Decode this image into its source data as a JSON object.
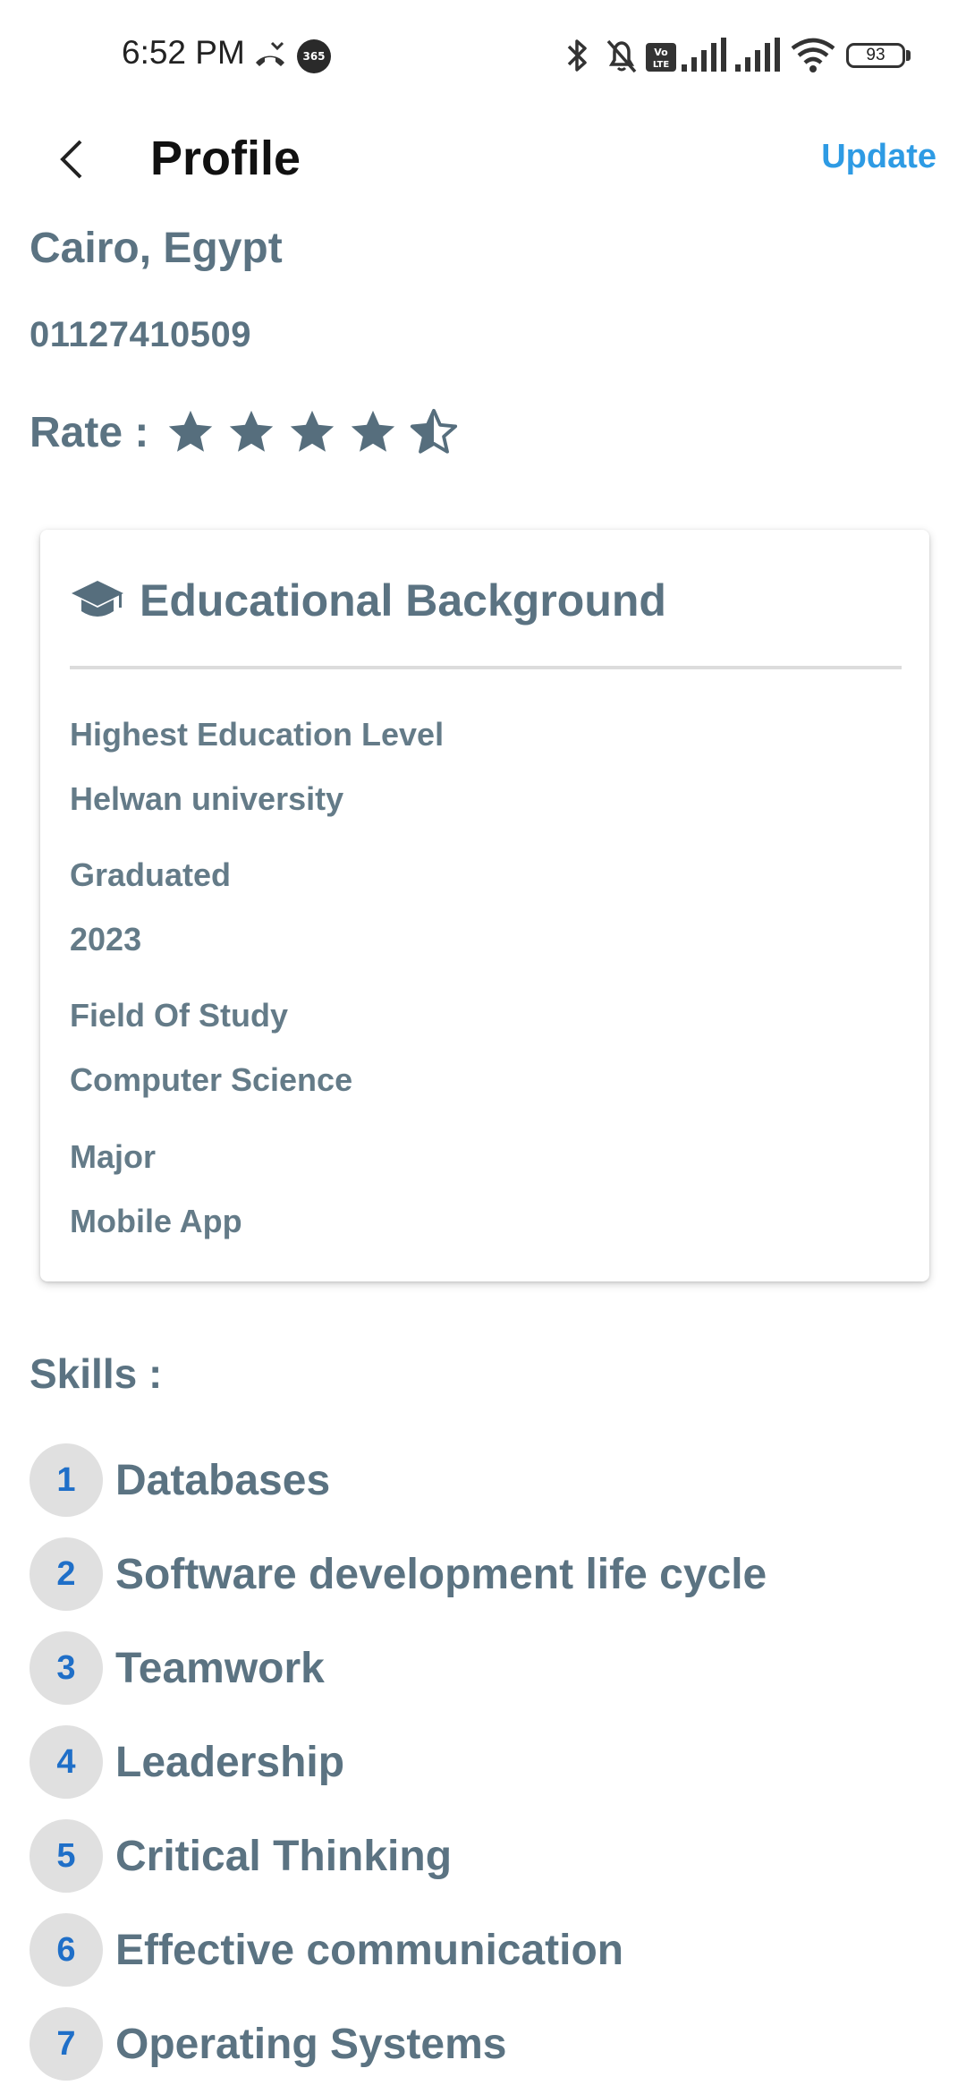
{
  "status_bar": {
    "time": "6:52 PM",
    "app_badge": "365",
    "volte": "Vo LTE",
    "battery": "93"
  },
  "app_bar": {
    "title": "Profile",
    "action": "Update"
  },
  "profile": {
    "location": "Cairo, Egypt",
    "phone": "01127410509",
    "rate_label": "Rate :",
    "rating": 4.5,
    "rating_max": 5
  },
  "education": {
    "title": "Educational Background",
    "fields": [
      {
        "label": "Highest Education Level",
        "value": "Helwan university"
      },
      {
        "label": "Graduated",
        "value": "2023"
      },
      {
        "label": "Field Of Study",
        "value": "Computer Science"
      },
      {
        "label": "Major",
        "value": "Mobile App"
      }
    ]
  },
  "skills": {
    "heading": "Skills :",
    "items": [
      {
        "number": "1",
        "label": "Databases"
      },
      {
        "number": "2",
        "label": "Software development life cycle"
      },
      {
        "number": "3",
        "label": "Teamwork"
      },
      {
        "number": "4",
        "label": "Leadership"
      },
      {
        "number": "5",
        "label": "Critical Thinking"
      },
      {
        "number": "6",
        "label": "Effective communication"
      },
      {
        "number": "7",
        "label": "Operating Systems"
      }
    ]
  },
  "colors": {
    "accent": "#2e9be4",
    "text": "#5b7382",
    "number": "#1f6fc8",
    "star": "#566e7d"
  }
}
